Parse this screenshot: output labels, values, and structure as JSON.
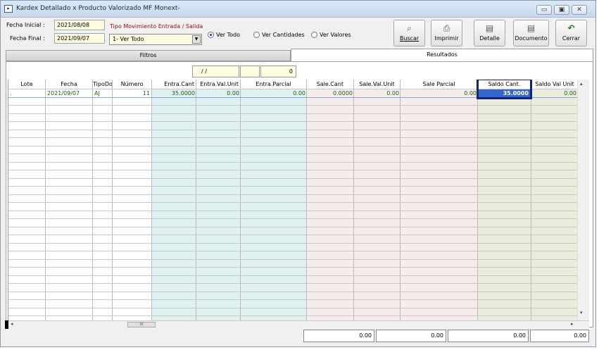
{
  "window": {
    "title": "Kardex Detallado x Producto Valorizado MF Monext-",
    "minimize": "▭",
    "maximize": "▣",
    "close": "✕"
  },
  "form": {
    "fecha_inicial_label": "Fecha Inicial :",
    "fecha_inicial_value": "2021/08/08",
    "fecha_final_label": "Fecha Final :",
    "fecha_final_value": "2021/09/07",
    "tipo_label": "Tipo Movimiento  Entrada / Salida",
    "tipo_value": "1- Ver Todo",
    "radios": [
      {
        "label": "Ver Todo",
        "checked": true
      },
      {
        "label": "Ver Cantidades",
        "checked": false
      },
      {
        "label": "Ver Valores",
        "checked": false
      }
    ]
  },
  "toolbar": {
    "buscar": "Buscar",
    "imprimir": "Imprimir",
    "detalle": "Detalle",
    "documento": "Documento",
    "cerrar": "Cerrar"
  },
  "tabs": {
    "filtros": "Filtros",
    "resultados": "Resultados"
  },
  "filters": {
    "date": " / /",
    "count": "0"
  },
  "table": {
    "columns": [
      "Lote",
      "Fecha",
      "TipoDoc",
      "Número",
      "Entra.Cant",
      "Entra.Val.Unit",
      "Entra.Parcial",
      "Sale.Cant",
      "Sale.Val.Unit",
      "Sale Parcial",
      "Saldo Cant.",
      "Saldo Val Unit"
    ],
    "rows": [
      {
        "lote": ".",
        "fecha": "2021/09/07",
        "tipodoc": "AJ",
        "numero": "11",
        "entra_cant": "35.0000",
        "entra_val_unit": "0.00",
        "entra_parcial": "0.00",
        "sale_cant": "0.0000",
        "sale_val_unit": "0.00",
        "sale_parcial": "0.00",
        "saldo_cant": "35.0000",
        "saldo_val_unit": "0.00"
      }
    ]
  },
  "totals": [
    "0.00",
    "0.00",
    "0.00",
    "0.00"
  ],
  "scrollbar": {
    "thumb": "III",
    "left": "◂",
    "right": "▸",
    "up": "▴",
    "down": "▾"
  }
}
